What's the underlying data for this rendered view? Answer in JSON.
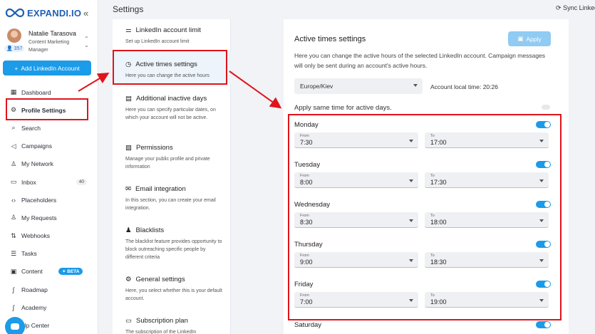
{
  "brand": {
    "name": "EXPANDI.IO"
  },
  "user": {
    "name": "Natalie Tarasova",
    "role": "Content Marketing Manager",
    "connections": "357"
  },
  "sidebar": {
    "add_button": "Add LinkedIn Account",
    "items": [
      {
        "label": "Dashboard",
        "icon": "grid-icon"
      },
      {
        "label": "Profile Settings",
        "icon": "gear-icon"
      },
      {
        "label": "Search",
        "icon": "search-icon"
      },
      {
        "label": "Campaigns",
        "icon": "megaphone-icon"
      },
      {
        "label": "My Network",
        "icon": "network-icon"
      },
      {
        "label": "Inbox",
        "icon": "inbox-icon",
        "count": "40"
      },
      {
        "label": "Placeholders",
        "icon": "code-icon"
      },
      {
        "label": "My Requests",
        "icon": "add-user-icon"
      },
      {
        "label": "Webhooks",
        "icon": "webhook-icon"
      },
      {
        "label": "Tasks",
        "icon": "list-icon"
      },
      {
        "label": "Content",
        "icon": "content-icon",
        "badge": "BETA"
      },
      {
        "label": "Roadmap",
        "icon": "roadmap-icon"
      },
      {
        "label": "Academy",
        "icon": "academy-icon"
      },
      {
        "label": "elp Center",
        "icon": "help-icon"
      }
    ]
  },
  "header": {
    "title": "Settings",
    "sync": "Sync Linkedin"
  },
  "settings_list": [
    {
      "title": "LinkedIn account limit",
      "desc": "Set up LinkedIn account limit"
    },
    {
      "title": "Active times settings",
      "desc": "Here you can change the active hours"
    },
    {
      "title": "Additional inactive days",
      "desc": "Here you can specify particular dates, on which your account will not be active."
    },
    {
      "title": "Permissions",
      "desc": "Manage your public profile and private information"
    },
    {
      "title": "Email integration",
      "desc": "In this section, you can create your email integration."
    },
    {
      "title": "Blacklists",
      "desc": "The blacklist feature provides opportunity to block outreaching specific people by different criteria"
    },
    {
      "title": "General settings",
      "desc": "Here, you select whether this is your default account."
    },
    {
      "title": "Subscription plan",
      "desc": "The subscription of the LinkedIn"
    }
  ],
  "panel": {
    "title": "Active times settings",
    "apply": "Apply",
    "description": "Here you can change the active hours of the selected LinkedIn account. Campaign messages will only be sent during an account's active hours.",
    "timezone": "Europe/Kiev",
    "local_time": "Account local time: 20:26",
    "same_time": "Apply same time for active days.",
    "from_label": "From",
    "to_label": "To",
    "days": [
      {
        "name": "Monday",
        "from": "7:30",
        "to": "17:00"
      },
      {
        "name": "Tuesday",
        "from": "8:00",
        "to": "17:30"
      },
      {
        "name": "Wednesday",
        "from": "8:30",
        "to": "18:00"
      },
      {
        "name": "Thursday",
        "from": "9:00",
        "to": "18:30"
      },
      {
        "name": "Friday",
        "from": "7:00",
        "to": "19:00"
      },
      {
        "name": "Saturday"
      }
    ]
  }
}
